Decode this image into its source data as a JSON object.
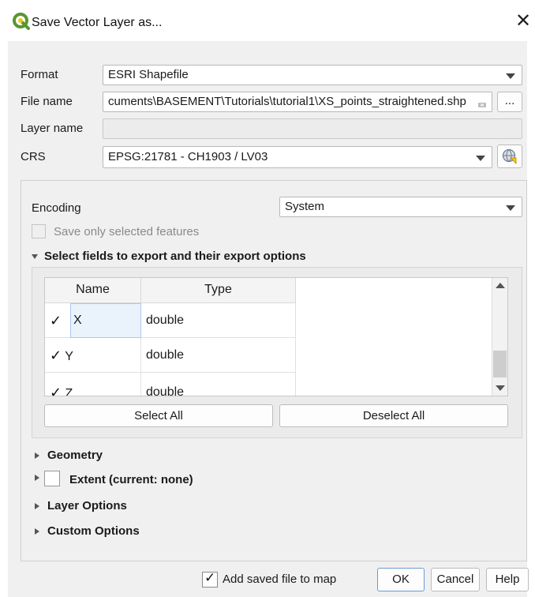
{
  "window": {
    "title": "Save Vector Layer as...",
    "close_glyph": "✕"
  },
  "form": {
    "format_label": "Format",
    "format_value": "ESRI Shapefile",
    "filename_label": "File name",
    "filename_value": "cuments\\BASEMENT\\Tutorials\\tutorial1\\XS_points_straightened.shp",
    "browse_label": "...",
    "layername_label": "Layer name",
    "layername_value": "",
    "crs_label": "CRS",
    "crs_value": "EPSG:21781 - CH1903 / LV03"
  },
  "options": {
    "encoding_label": "Encoding",
    "encoding_value": "System",
    "save_selected_label": "Save only selected features",
    "fields_header": "Select fields to export and their export options",
    "table": {
      "columns": [
        "Name",
        "Type"
      ],
      "rows": [
        {
          "check": "✓",
          "name": "X",
          "type": "double"
        },
        {
          "check": "✓",
          "name": "Y",
          "type": "double"
        },
        {
          "check": "✓",
          "name": "Z",
          "type": "double"
        }
      ]
    },
    "select_all_label": "Select All",
    "deselect_all_label": "Deselect All",
    "geometry_label": "Geometry",
    "extent_label": "Extent (current: none)",
    "layer_options_label": "Layer Options",
    "custom_options_label": "Custom Options"
  },
  "footer": {
    "add_to_map_check": "✓",
    "add_to_map_label": "Add saved file to map",
    "ok_label": "OK",
    "cancel_label": "Cancel",
    "help_label": "Help"
  },
  "colors": {
    "qgis_green": "#589632",
    "qgis_yellow": "#f2c811",
    "focus_blue": "#6b9bd6"
  }
}
